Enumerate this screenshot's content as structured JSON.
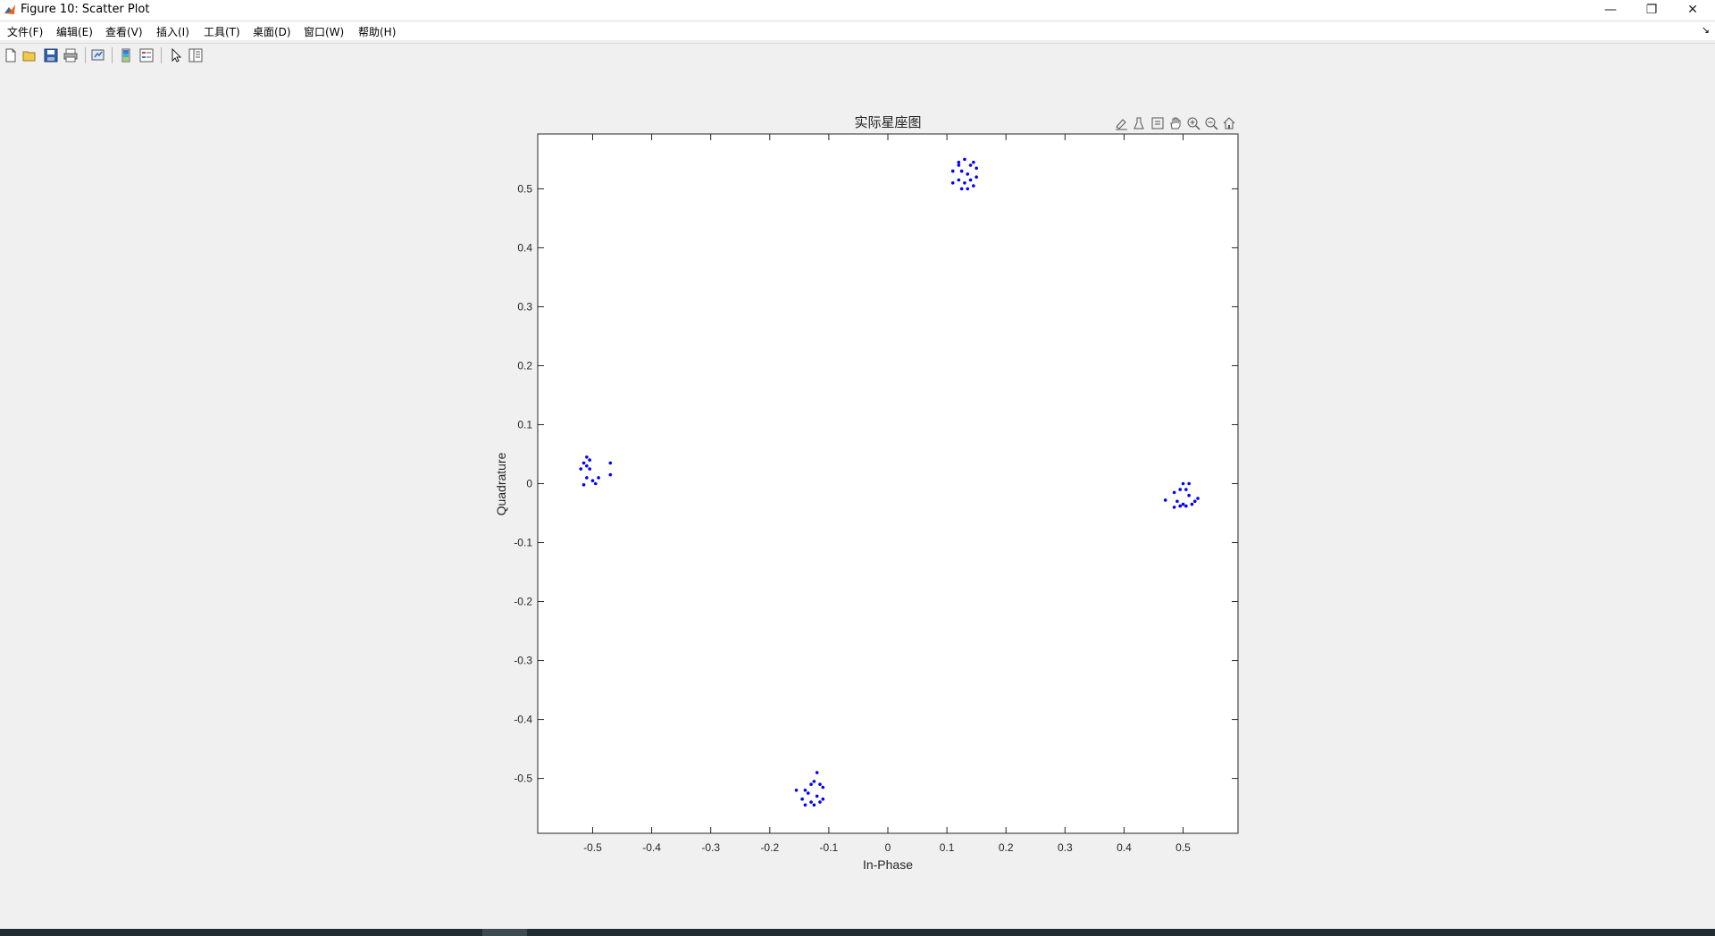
{
  "window": {
    "title": "Figure 10: Scatter Plot",
    "minimize_glyph": "—",
    "restore_glyph": "❐",
    "close_glyph": "✕"
  },
  "menu": {
    "items": [
      "文件(F)",
      "编辑(E)",
      "查看(V)",
      "插入(I)",
      "工具(T)",
      "桌面(D)",
      "窗口(W)",
      "帮助(H)"
    ],
    "overflow_glyph": "↘"
  },
  "toolbar": {
    "buttons": [
      "new-figure-icon",
      "open-file-icon",
      "save-icon",
      "print-icon",
      "link-plot-icon",
      "colorbar-icon",
      "legend-icon",
      "edit-plot-arrow-icon",
      "property-inspector-icon"
    ]
  },
  "axes_toolbar": {
    "buttons": [
      "data-tips-brush-icon",
      "brush-icon",
      "data-cursor-icon",
      "pan-hand-icon",
      "zoom-in-icon",
      "zoom-out-icon",
      "restore-view-home-icon"
    ]
  },
  "colors": {
    "marker": "#0000ff",
    "axes_bg": "#ffffff",
    "figure_bg": "#f0f0f0"
  },
  "chart_data": {
    "type": "scatter",
    "title": "实际星座图",
    "xlabel": "In-Phase",
    "ylabel": "Quadrature",
    "xlim": [
      -0.593,
      0.593
    ],
    "ylim": [
      -0.593,
      0.593
    ],
    "xticks": [
      -0.5,
      -0.4,
      -0.3,
      -0.2,
      -0.1,
      0,
      0.1,
      0.2,
      0.3,
      0.4,
      0.5
    ],
    "yticks": [
      -0.5,
      -0.4,
      -0.3,
      -0.2,
      -0.1,
      0,
      0.1,
      0.2,
      0.3,
      0.4,
      0.5
    ],
    "grid": false,
    "marker": "point",
    "series": [
      {
        "points": [
          [
            0.13,
            0.55
          ],
          [
            0.14,
            0.54
          ],
          [
            0.12,
            0.54
          ],
          [
            0.15,
            0.535
          ],
          [
            0.11,
            0.53
          ],
          [
            0.125,
            0.53
          ],
          [
            0.135,
            0.525
          ],
          [
            0.15,
            0.52
          ],
          [
            0.12,
            0.515
          ],
          [
            0.14,
            0.515
          ],
          [
            0.13,
            0.51
          ],
          [
            0.11,
            0.51
          ],
          [
            0.145,
            0.505
          ],
          [
            0.125,
            0.5
          ],
          [
            0.135,
            0.5
          ],
          [
            0.12,
            0.545
          ],
          [
            0.145,
            0.545
          ],
          [
            -0.51,
            0.045
          ],
          [
            -0.505,
            0.04
          ],
          [
            -0.515,
            0.035
          ],
          [
            -0.47,
            0.035
          ],
          [
            -0.51,
            0.03
          ],
          [
            -0.52,
            0.025
          ],
          [
            -0.505,
            0.025
          ],
          [
            -0.47,
            0.015
          ],
          [
            -0.51,
            0.01
          ],
          [
            -0.49,
            0.01
          ],
          [
            -0.5,
            0.005
          ],
          [
            -0.495,
            0.0
          ],
          [
            -0.515,
            -0.002
          ],
          [
            0.5,
            0.0
          ],
          [
            0.51,
            0.0
          ],
          [
            0.505,
            -0.01
          ],
          [
            0.495,
            -0.01
          ],
          [
            0.485,
            -0.015
          ],
          [
            0.51,
            -0.02
          ],
          [
            0.525,
            -0.025
          ],
          [
            0.47,
            -0.028
          ],
          [
            0.49,
            -0.03
          ],
          [
            0.5,
            -0.035
          ],
          [
            0.515,
            -0.035
          ],
          [
            0.495,
            -0.038
          ],
          [
            0.505,
            -0.038
          ],
          [
            0.485,
            -0.04
          ],
          [
            0.52,
            -0.03
          ],
          [
            -0.12,
            -0.49
          ],
          [
            -0.125,
            -0.505
          ],
          [
            -0.13,
            -0.51
          ],
          [
            -0.115,
            -0.51
          ],
          [
            -0.11,
            -0.515
          ],
          [
            -0.14,
            -0.52
          ],
          [
            -0.155,
            -0.52
          ],
          [
            -0.135,
            -0.525
          ],
          [
            -0.12,
            -0.53
          ],
          [
            -0.145,
            -0.535
          ],
          [
            -0.11,
            -0.535
          ],
          [
            -0.13,
            -0.54
          ],
          [
            -0.125,
            -0.545
          ],
          [
            -0.14,
            -0.545
          ],
          [
            -0.115,
            -0.54
          ]
        ]
      }
    ]
  }
}
